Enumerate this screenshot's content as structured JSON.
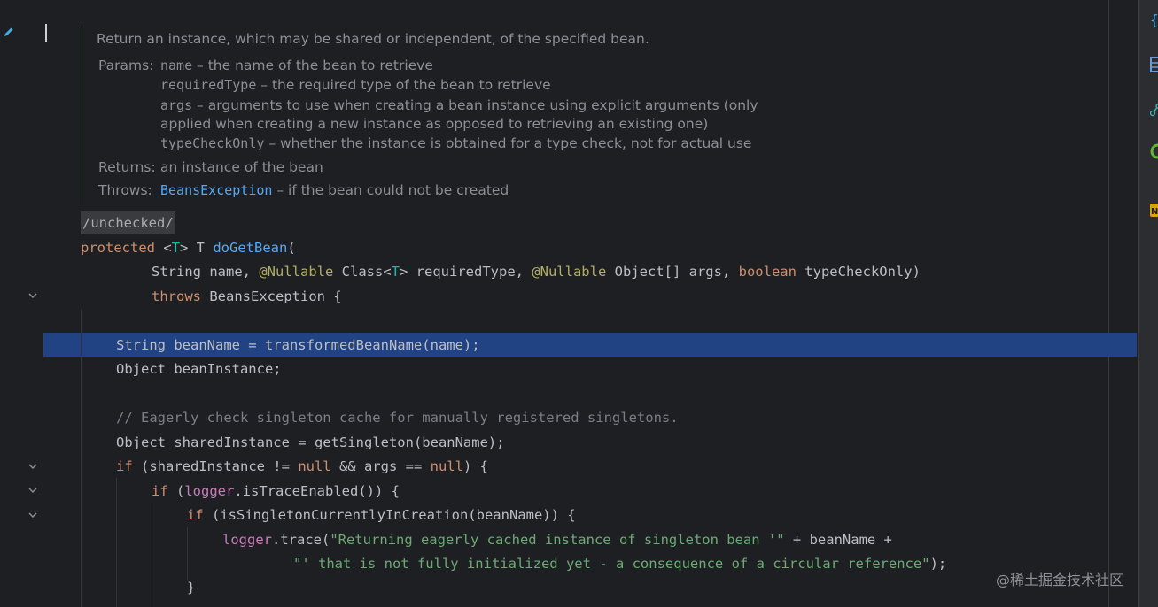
{
  "doc": {
    "summary": "Return an instance, which may be shared or independent, of the specified bean.",
    "params_label": "Params:",
    "params": [
      {
        "name": "name",
        "desc": " – the name of the bean to retrieve"
      },
      {
        "name": "requiredType",
        "desc": " – the required type of the bean to retrieve"
      },
      {
        "name": "args",
        "desc": " – arguments to use when creating a bean instance using explicit arguments (only"
      },
      {
        "name": "",
        "desc": "applied when creating a new instance as opposed to retrieving an existing one)"
      },
      {
        "name": "typeCheckOnly",
        "desc": " – whether the instance is obtained for a type check, not for actual use"
      }
    ],
    "returns_label": "Returns:",
    "returns": "an instance of the bean",
    "throws_label": "Throws:",
    "throws_link": "BeansException",
    "throws_desc": " – if the bean could not be created"
  },
  "annotation": "/unchecked/",
  "code": {
    "l1": {
      "kw": "protected",
      "t1": " <",
      "tp": "T",
      "t2": "> T ",
      "fn": "doGetBean",
      "t3": "("
    },
    "l2": {
      "t1": "String name, ",
      "an1": "@Nullable",
      "t2": " Class<",
      "tp": "T",
      "t3": "> requiredType, ",
      "an2": "@Nullable",
      "t4": " Object[] args, ",
      "kw": "boolean",
      "t5": " typeCheckOnly)"
    },
    "l3": {
      "kw": "throws",
      "t1": " BeansException {"
    },
    "l4": "String beanName = transformedBeanName(name);",
    "l5": "Object beanInstance;",
    "l6": "// Eagerly check singleton cache for manually registered singletons.",
    "l7": "Object sharedInstance = getSingleton(beanName);",
    "l8": {
      "kw": "if",
      "t1": " (sharedInstance != ",
      "kw2": "null",
      "t2": " && args == ",
      "kw3": "null",
      "t3": ") {"
    },
    "l9": {
      "kw": "if",
      "t1": " (",
      "fld": "logger",
      "t2": ".isTraceEnabled()) {"
    },
    "l10": {
      "kw": "if",
      "t1": " (isSingletonCurrentlyInCreation(beanName)) {"
    },
    "l11": {
      "fld": "logger",
      "t1": ".trace(",
      "str": "\"Returning eagerly cached instance of singleton bean '\"",
      "t2": " + beanName +"
    },
    "l12": {
      "str": "\"' that is not fully initialized yet - a consequence of a circular reference\"",
      "t1": ");"
    },
    "l13": "}"
  },
  "watermark": "@稀土掘金技术社区",
  "colors": {
    "background": "#1e1f22",
    "selection": "#214283",
    "keyword": "#cf8e6d",
    "function": "#56a8f5",
    "string": "#6aab73"
  }
}
